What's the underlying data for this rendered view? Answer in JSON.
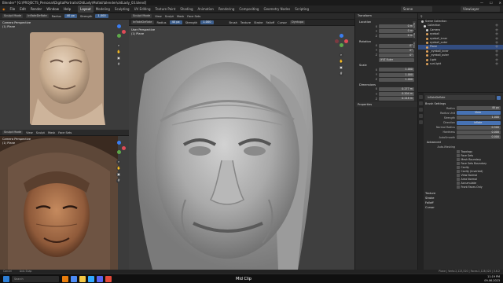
{
  "window": {
    "title": "Blender* [G:\\PROJECTS_Personal\\DigitalPortraits\\OldLady\\Mofaki\\blender\\oldLady_03.blend]"
  },
  "menu": {
    "items": [
      "File",
      "Edit",
      "Render",
      "Window",
      "Help"
    ],
    "workspaces": [
      "Layout",
      "Modeling",
      "Sculpting",
      "UV Editing",
      "Texture Paint",
      "Shading",
      "Animation",
      "Rendering",
      "Compositing",
      "Geometry Nodes",
      "Scripting"
    ],
    "active_workspace": "Layout",
    "scene": "Scene",
    "view_layer": "ViewLayer"
  },
  "ref_viewport_top": {
    "mode": "Sculpt Mode",
    "brush": "InflateDeflate",
    "radius_label": "Radius",
    "radius": "40 px",
    "strength_label": "Strength",
    "strength": "1.000",
    "view_title": "Camera Perspective",
    "object": "(1) Plane"
  },
  "ref_viewport_bottom": {
    "mode": "Sculpt Mode",
    "menus": [
      "View",
      "Sculpt",
      "Mask",
      "Face Sets"
    ],
    "view_title": "Camera Perspective",
    "object": "(1) Plane"
  },
  "main_viewport": {
    "mode": "Sculpt Mode",
    "menus": [
      "View",
      "Sculpt",
      "Mask",
      "Face Sets"
    ],
    "brush": "InflateDeflate",
    "radius_label": "Radius",
    "radius": "40 px",
    "strength_label": "Strength",
    "strength": "1.000",
    "right_menus": [
      "Brush",
      "Texture",
      "Stroke",
      "Falloff",
      "Cursor"
    ],
    "dyntopo": "Dyntopo",
    "view_title": "User Perspective",
    "object": "(1) Plane"
  },
  "npanel": {
    "tabs": [
      "Item",
      "Tool",
      "View"
    ],
    "transform_title": "Transform",
    "location_label": "Location",
    "location": [
      "0 m",
      "0 m",
      "0 m"
    ],
    "rotation_label": "Rotation",
    "rotation": [
      "0°",
      "0°",
      "0°"
    ],
    "euler": "XYZ Euler",
    "scale_label": "Scale",
    "scale": [
      "1.000",
      "1.000",
      "1.000"
    ],
    "dimensions_label": "Dimensions",
    "dimensions": [
      "0.277 m",
      "0.204 m",
      "0.218 m"
    ],
    "axes": [
      "X",
      "Y",
      "Z"
    ],
    "properties": "Properties"
  },
  "outliner": {
    "title": "Scene Collection",
    "items": [
      {
        "name": "Collection",
        "color": "#d9d9d9"
      },
      {
        "name": "Camera",
        "color": "#d4d4d4"
      },
      {
        "name": "eyeball",
        "color": "#e0a25a"
      },
      {
        "name": "eyeball_inner",
        "color": "#e0a25a"
      },
      {
        "name": "eyeball_outer",
        "color": "#e0a25a"
      },
      {
        "name": "Plane",
        "color": "#e0a25a"
      },
      {
        "name": "_eyeball_inner",
        "color": "#e0a25a"
      },
      {
        "name": "_eyeball_outer",
        "color": "#e0a25a"
      },
      {
        "name": "Light",
        "color": "#e0a25a"
      },
      {
        "name": "sunLight",
        "color": "#e0a25a"
      }
    ]
  },
  "properties": {
    "brush_name": "InflateDeflate",
    "brush_settings": "Brush Settings",
    "fields": [
      {
        "label": "Radius",
        "value": "40 px"
      },
      {
        "label": "Radius Unit",
        "value": "View"
      },
      {
        "label": "Strength",
        "value": "1.000"
      },
      {
        "label": "Direction",
        "value": "Inflate"
      },
      {
        "label": "Normal Radius",
        "value": "0.500"
      },
      {
        "label": "Hardness",
        "value": "0.000"
      },
      {
        "label": "AutoSmooth",
        "value": "0.000"
      }
    ],
    "advanced": "Advanced",
    "auto_masking": "Auto-Masking",
    "checks": [
      "Topology",
      "Face Sets",
      "Mesh Boundary",
      "Face Sets Boundary",
      "Cavity",
      "Cavity (Inverted)",
      "View Normal",
      "Area Normal",
      "Accumulate",
      "Front Faces Only"
    ],
    "sections": [
      "Texture",
      "Stroke",
      "Falloff",
      "Cursor"
    ]
  },
  "status": {
    "left": "Cancel",
    "mid": "Axis Snap",
    "right": "Plane | Verts:2,123,520 | Faces:1,128,520 | 3.6.2"
  },
  "taskbar": {
    "time": "11:19 PM",
    "date": "09-06-2023",
    "search": "Search",
    "media": "Mid Clip"
  }
}
